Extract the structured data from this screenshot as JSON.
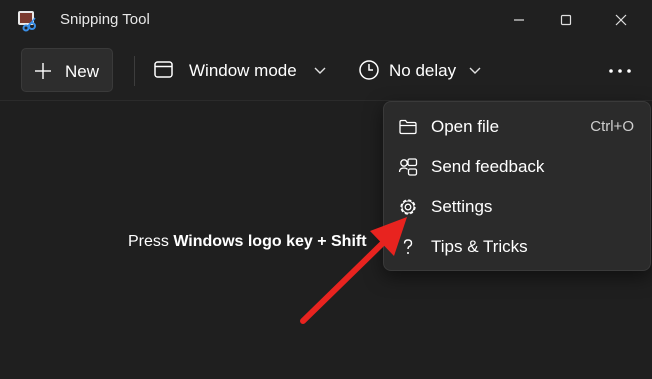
{
  "window": {
    "title": "Snipping Tool",
    "controls": [
      "minimize",
      "maximize",
      "close"
    ]
  },
  "toolbar": {
    "new_label": "New",
    "mode_label": "Window mode",
    "delay_label": "No delay",
    "more_label": "..."
  },
  "canvas": {
    "message_prefix": "Press ",
    "message_bold": "Windows logo key + Shift"
  },
  "menu": {
    "items": [
      {
        "label": "Open file",
        "shortcut": "Ctrl+O",
        "icon": "folder-icon"
      },
      {
        "label": "Send feedback",
        "shortcut": "",
        "icon": "feedback-icon"
      },
      {
        "label": "Settings",
        "shortcut": "",
        "icon": "gear-icon"
      },
      {
        "label": "Tips & Tricks",
        "shortcut": "",
        "icon": "question-icon"
      }
    ]
  },
  "colors": {
    "background": "#1f1f1f",
    "titlebar": "#202020",
    "menu": "#2b2b2b",
    "annotation_arrow": "#e8231f"
  }
}
